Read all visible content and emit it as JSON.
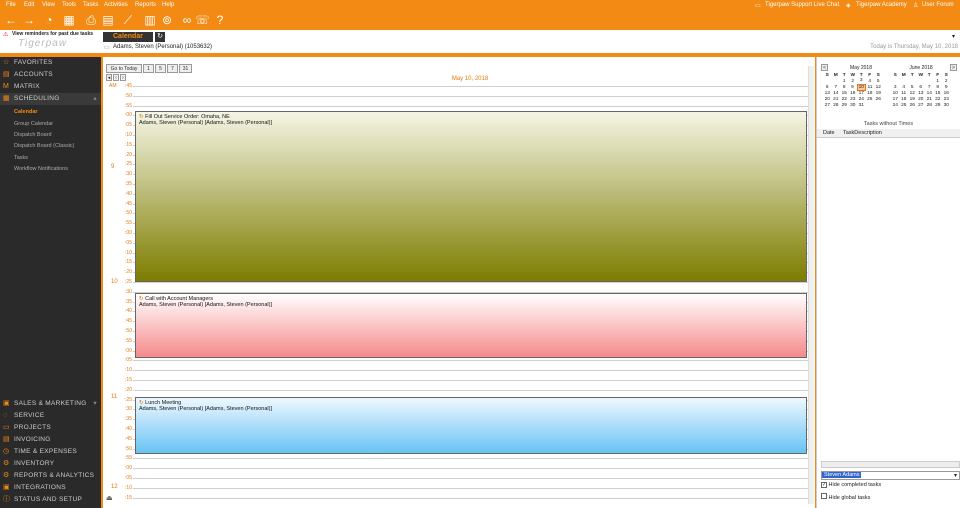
{
  "menu": [
    "File",
    "Edit",
    "View",
    "Tools",
    "Tasks",
    "Activities",
    "Reports",
    "Help"
  ],
  "menu_right": [
    "Tigerpaw Support Live Chat",
    "Tigerpaw Academy",
    "User Forum"
  ],
  "header": {
    "reminder": "View reminders for past due tasks",
    "logo": "Tigerpaw",
    "tab": "Calendar",
    "contact": "Adams, Steven (Personal) (1053632)",
    "today": "Today is Thursday, May 10, 2018"
  },
  "nav_top": [
    "FAVORITES",
    "ACCOUNTS",
    "MATRIX",
    "SCHEDULING"
  ],
  "nav_sub": [
    "Calendar",
    "Group Calendar",
    "Dispatch Board",
    "Dispatch Board (Classic)",
    "Tasks",
    "Workflow Notifications"
  ],
  "nav_bottom": [
    "SALES & MARKETING",
    "SERVICE",
    "PROJECTS",
    "INVOICING",
    "TIME & EXPENSES",
    "INVENTORY",
    "REPORTS & ANALYTICS",
    "INTEGRATIONS",
    "STATUS AND SETUP"
  ],
  "calendar": {
    "go_today": "Go to Today",
    "date": "May 10, 2018",
    "day_buttons": [
      "1",
      "5",
      "7",
      "31"
    ],
    "times": [
      [
        "AM",
        ":45"
      ],
      [
        "",
        ":50"
      ],
      [
        "",
        ":55"
      ],
      [
        "",
        ":00"
      ],
      [
        "",
        ":05"
      ],
      [
        "",
        ":10"
      ],
      [
        "",
        ":15"
      ],
      [
        "",
        ":20"
      ],
      [
        "",
        ":25"
      ],
      [
        "",
        ":30"
      ],
      [
        "",
        ":35"
      ],
      [
        "",
        ":40"
      ],
      [
        "",
        ":45"
      ],
      [
        "",
        ":50"
      ],
      [
        "",
        ":55"
      ],
      [
        "",
        ":00"
      ],
      [
        "",
        ":05"
      ],
      [
        "",
        ":10"
      ],
      [
        "",
        ":15"
      ],
      [
        "",
        ":20"
      ],
      [
        "",
        ":25"
      ],
      [
        "",
        ":30"
      ],
      [
        "",
        ":35"
      ],
      [
        "",
        ":40"
      ],
      [
        "",
        ":45"
      ],
      [
        "",
        ":50"
      ],
      [
        "",
        ":55"
      ],
      [
        "",
        ":00"
      ],
      [
        "",
        ":05"
      ],
      [
        "",
        ":10"
      ],
      [
        "",
        ":15"
      ],
      [
        "",
        ":20"
      ],
      [
        "",
        ":25"
      ],
      [
        "",
        ":30"
      ],
      [
        "",
        ":35"
      ],
      [
        "",
        ":40"
      ],
      [
        "",
        ":45"
      ],
      [
        "",
        ":50"
      ],
      [
        "",
        ":55"
      ],
      [
        "",
        ":00"
      ],
      [
        "",
        ":05"
      ],
      [
        "",
        ":10"
      ],
      [
        "",
        ":15"
      ]
    ],
    "hours": [
      "9",
      "10",
      "11",
      "12"
    ],
    "appointments": [
      {
        "title": "Fill Out Service Order: Omaha, NE",
        "who": "Adams, Steven (Personal) [Adams, Steven (Personal)]"
      },
      {
        "title": "Call with Account Managers",
        "who": "Adams, Steven (Personal) [Adams, Steven (Personal)]"
      },
      {
        "title": "Lunch Meeting",
        "who": "Adams, Steven (Personal) [Adams, Steven (Personal)]"
      }
    ]
  },
  "right": {
    "may": "May 2018",
    "june": "June 2018",
    "dow": [
      "S",
      "M",
      "T",
      "W",
      "T",
      "F",
      "S"
    ],
    "may_days": [
      [
        "",
        "",
        "1",
        "2",
        "3",
        "4",
        "5"
      ],
      [
        "6",
        "7",
        "8",
        "9",
        "10",
        "11",
        "12"
      ],
      [
        "13",
        "14",
        "15",
        "16",
        "17",
        "18",
        "19"
      ],
      [
        "20",
        "21",
        "22",
        "23",
        "24",
        "25",
        "26"
      ],
      [
        "27",
        "28",
        "29",
        "30",
        "31",
        "",
        ""
      ]
    ],
    "june_days": [
      [
        "",
        "",
        "",
        "",
        "",
        "1",
        "2"
      ],
      [
        "3",
        "4",
        "5",
        "6",
        "7",
        "8",
        "9"
      ],
      [
        "10",
        "11",
        "12",
        "13",
        "14",
        "15",
        "16"
      ],
      [
        "17",
        "18",
        "19",
        "20",
        "21",
        "22",
        "23"
      ],
      [
        "24",
        "25",
        "26",
        "27",
        "28",
        "29",
        "30"
      ]
    ],
    "tasks_title": "Tasks without Times",
    "col_date": "Date",
    "col_desc": "TaskDescription",
    "user": "Steven Adams",
    "hide_completed": "Hide completed tasks",
    "hide_global": "Hide global tasks"
  }
}
